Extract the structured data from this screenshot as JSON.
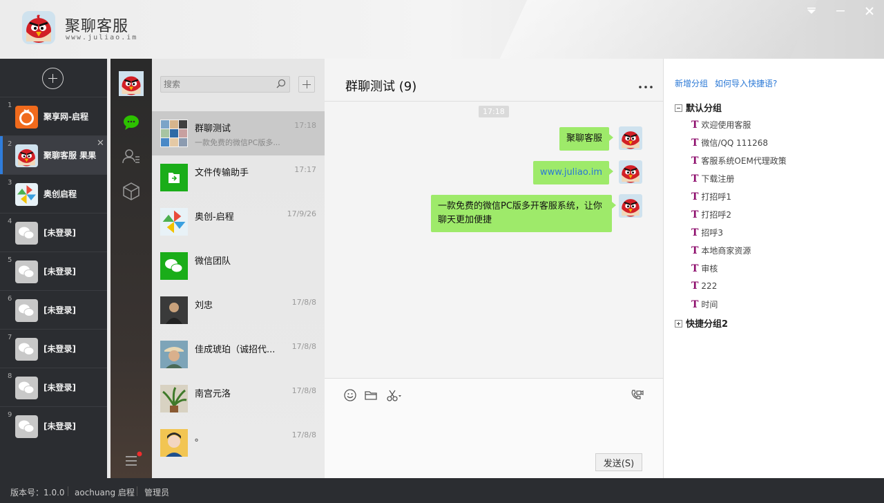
{
  "app": {
    "name": "聚聊客服",
    "url": "www.juliao.im"
  },
  "window_controls": [
    "dropdown-icon",
    "minimize-icon",
    "close-icon"
  ],
  "accounts": [
    {
      "index": "1",
      "name": "聚享网-启程",
      "avatar": "orange-ring"
    },
    {
      "index": "2",
      "name": "聚聊客服 果果",
      "avatar": "angry-bird",
      "active": true
    },
    {
      "index": "3",
      "name": "奥创启程",
      "avatar": "pinwheel"
    },
    {
      "index": "4",
      "name": "[未登录]",
      "avatar": "wechat-gray"
    },
    {
      "index": "5",
      "name": "[未登录]",
      "avatar": "wechat-gray"
    },
    {
      "index": "6",
      "name": "[未登录]",
      "avatar": "wechat-gray"
    },
    {
      "index": "7",
      "name": "[未登录]",
      "avatar": "wechat-gray"
    },
    {
      "index": "8",
      "name": "[未登录]",
      "avatar": "wechat-gray"
    },
    {
      "index": "9",
      "name": "[未登录]",
      "avatar": "wechat-gray"
    }
  ],
  "nav": [
    "profile-avatar",
    "chat-icon",
    "contacts-icon",
    "box-icon",
    "menu-icon"
  ],
  "search": {
    "placeholder": "搜索"
  },
  "conversations": [
    {
      "name": "群聊测试",
      "time": "17:18",
      "preview": "一款免费的微信PC版多...",
      "avatar": "group-grid",
      "active": true
    },
    {
      "name": "文件传输助手",
      "time": "17:17",
      "preview": "",
      "avatar": "file-transfer"
    },
    {
      "name": "奥创-启程",
      "time": "17/9/26",
      "preview": "",
      "avatar": "pinwheel"
    },
    {
      "name": "微信团队",
      "time": "",
      "preview": "",
      "avatar": "wechat-team"
    },
    {
      "name": "刘忠",
      "time": "17/8/8",
      "preview": "",
      "avatar": "photo-dark"
    },
    {
      "name": "佳成琥珀（诚招代...",
      "time": "17/8/8",
      "preview": "",
      "avatar": "photo-man"
    },
    {
      "name": "南宫元洛",
      "time": "17/8/8",
      "preview": "",
      "avatar": "photo-plant"
    },
    {
      "name": "。",
      "time": "17/8/8",
      "preview": "",
      "avatar": "photo-cartoon"
    }
  ],
  "chat": {
    "title": "群聊测试 (9)",
    "time_badge": "17:18",
    "messages": [
      {
        "text": "聚聊客服",
        "type": "text"
      },
      {
        "text": "www.juliao.im",
        "type": "link"
      },
      {
        "text": "一款免费的微信PC版多开客服系统，让你聊天更加便捷",
        "type": "text"
      }
    ],
    "send_label": "发送(S)"
  },
  "quick": {
    "add_group": "新增分组",
    "import_help": "如何导入快捷语?",
    "groups": [
      {
        "name": "默认分组",
        "expanded": true,
        "items": [
          "欢迎使用客服",
          "微信/QQ 111268",
          "客服系统OEM代理政策",
          "下载注册",
          "打招呼1",
          "打招呼2",
          "招呼3",
          "本地商家资源",
          "审核",
          "222",
          "时间"
        ]
      },
      {
        "name": "快捷分组2",
        "expanded": false,
        "items": []
      }
    ]
  },
  "status": {
    "version": "版本号：1.0.0",
    "user": "aochuang 启程",
    "role": "管理员"
  },
  "colors": {
    "accent_green": "#9eea6a",
    "link_blue": "#2a78d6",
    "active_blue": "#2f7ddc",
    "quick_t": "#8e0f6d",
    "dark_bg": "#2b2d31"
  }
}
